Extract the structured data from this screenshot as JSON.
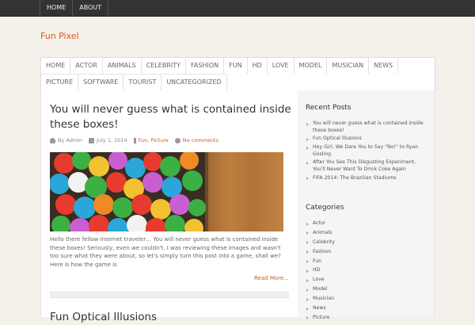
{
  "topnav": [
    "HOME",
    "ABOUT"
  ],
  "site": {
    "title": "Fun Pixel"
  },
  "categories_nav": {
    "row1": [
      "HOME",
      "ACTOR",
      "ANIMALS",
      "CELEBRITY",
      "FASHION",
      "FUN",
      "HD",
      "LOVE",
      "MODEL",
      "MUSICIAN",
      "NEWS"
    ],
    "row2": [
      "PICTURE",
      "SOFTWARE",
      "TOURIST",
      "UNCATEGORIZED"
    ]
  },
  "post": {
    "title": "You will never guess what is contained inside these boxes!",
    "author": "By Admin",
    "date": "July 1, 2014",
    "tags": "Fun, Picture",
    "comments": "No comments",
    "excerpt": "Hello there fellow Internet traveler… You will never guess what is contained inside these boxes!  Seriously, even we couldn't.  I was reviewing these images and wasn't too sure what they were about, so let's simply turn this post into a game, shall we?  Here is how the game is",
    "read_more": "Read More..."
  },
  "post2": {
    "title": "Fun Optical Illusions"
  },
  "sidebar": {
    "recent_title": "Recent Posts",
    "recent": [
      "You will never guess what is contained inside these boxes!",
      "Fun Optical Illusions",
      "Hey Girl, We Dare You to Say \"No!\" to Ryan Gosling",
      "After You See This Disgusting Experiment, You'll Never Want To Drink Coke Again",
      "FIFA 2014: The Brazilian Stadiums"
    ],
    "categories_title": "Categories",
    "categories": [
      "Actor",
      "Animals",
      "Celebrity",
      "Fashion",
      "Fun",
      "HD",
      "Love",
      "Model",
      "Musician",
      "News",
      "Picture"
    ]
  },
  "colors": {
    "accent": "#d8581b",
    "topbar": "#333333"
  }
}
